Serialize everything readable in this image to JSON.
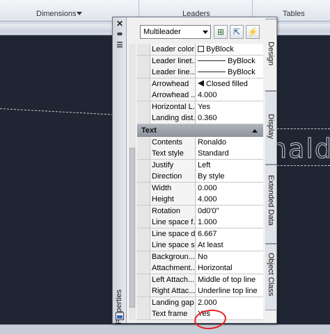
{
  "ribbon": {
    "panels": [
      "Dimensions",
      "Leaders",
      "Tables"
    ]
  },
  "drawing": {
    "leader_text": "naldo"
  },
  "palette": {
    "title": "Properties",
    "selection": "Multileader",
    "rows_top": [
      {
        "key": "Leader color",
        "value": "ByBlock",
        "swatch": "box"
      },
      {
        "key": "Leader linet...",
        "value": "ByBlock",
        "swatch": "line"
      },
      {
        "key": "Leader line...",
        "value": "ByBlock",
        "swatch": "line"
      },
      {
        "key": "Arrowhead",
        "value": "Closed filled",
        "swatch": "arrow"
      },
      {
        "key": "Arrowhead ...",
        "value": "4.000"
      },
      {
        "key": "Horizontal L...",
        "value": "Yes"
      },
      {
        "key": "Landing dist...",
        "value": "0.360"
      }
    ],
    "section_text": "Text",
    "rows_text": [
      {
        "key": "Contents",
        "value": "Ronaldo"
      },
      {
        "key": "Text style",
        "value": "Standard"
      },
      {
        "key": "Justify",
        "value": "Left"
      },
      {
        "key": "Direction",
        "value": "By style"
      },
      {
        "key": "Width",
        "value": "0.000"
      },
      {
        "key": "Height",
        "value": "4.000"
      },
      {
        "key": "Rotation",
        "value": "0d0'0\""
      },
      {
        "key": "Line space f...",
        "value": "1.000"
      },
      {
        "key": "Line space d...",
        "value": "6.667"
      },
      {
        "key": "Line space s...",
        "value": "At least"
      },
      {
        "key": "Backgroun...",
        "value": "No"
      },
      {
        "key": "Attachment...",
        "value": "Horizontal"
      },
      {
        "key": "Left Attach...",
        "value": "Middle of top line"
      },
      {
        "key": "Right Attac...",
        "value": "Underline top line"
      },
      {
        "key": "Landing gap",
        "value": "2.000"
      },
      {
        "key": "Text frame",
        "value": "Yes"
      }
    ],
    "tabs": [
      "Design",
      "Display",
      "Extended Data",
      "Object Class"
    ]
  }
}
